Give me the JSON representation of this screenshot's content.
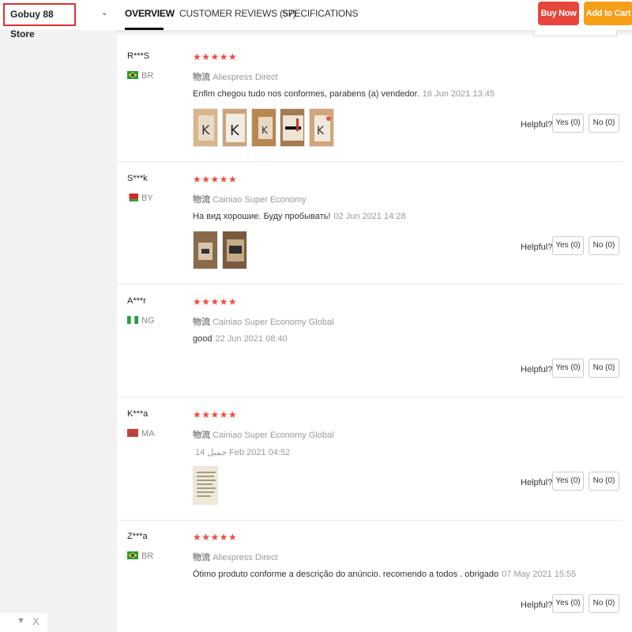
{
  "store": {
    "name": "Gobuy 88 Store",
    "chevron_icon": "chevron-down-icon"
  },
  "tabs": [
    {
      "label": "OVERVIEW",
      "active": true
    },
    {
      "label": "CUSTOMER REVIEWS (57)",
      "active": false
    },
    {
      "label": "SPECIFICATIONS",
      "active": false
    }
  ],
  "actions": {
    "buy_now": "Buy Now",
    "add_to_cart": "Add to Cart"
  },
  "colors": {
    "buy_now": "#e8453c",
    "add_to_cart": "#f59f18",
    "stars": "#f04a3c",
    "store_border": "#e0302e"
  },
  "reviews": [
    {
      "user": "R***S",
      "country": "BR",
      "flag": "brazil",
      "stars": "★★★★★",
      "rating": 5,
      "ship_cn": "物流",
      "shipping": "Aliexpress Direct",
      "text": "Enfim chegou tudo nos conformes, parabens (a) vendedor.",
      "date": "16 Jun 2021 13:45",
      "photos": 5,
      "helpful": "Helpful?",
      "yes": "Yes (0)",
      "no": "No (0)"
    },
    {
      "user": "S***k",
      "country": "BY",
      "flag": "belarus",
      "stars": "★★★★★",
      "rating": 5,
      "ship_cn": "物流",
      "shipping": "Cainiao Super Economy",
      "text": "На вид хорошие. Буду пробывать!",
      "date": "02 Jun 2021 14:28",
      "photos": 2,
      "helpful": "Helpful?",
      "yes": "Yes (0)",
      "no": "No (0)"
    },
    {
      "user": "A***r",
      "country": "NG",
      "flag": "nigeria",
      "stars": "★★★★★",
      "rating": 5,
      "ship_cn": "物流",
      "shipping": "Cainiao Super Economy Global",
      "text": "good",
      "date": "22 Jun 2021 08:40",
      "photos": 0,
      "helpful": "Helpful?",
      "yes": "Yes (0)",
      "no": "No (0)"
    },
    {
      "user": "K***a",
      "country": "MA",
      "flag": "morocco",
      "stars": "★★★★★",
      "rating": 5,
      "ship_cn": "物流",
      "shipping": "Cainiao Super Economy Global",
      "text": "",
      "date": "14 جميل Feb 2021 04:52",
      "photos": 1,
      "helpful": "Helpful?",
      "yes": "Yes (0)",
      "no": "No (0)"
    },
    {
      "user": "Z***a",
      "country": "BR",
      "flag": "brazil",
      "stars": "★★★★★",
      "rating": 5,
      "ship_cn": "物流",
      "shipping": "Aliexpress Direct",
      "text": "Ótimo produto conforme a descrição do anúncio. recomendo a todos . obrigado",
      "date": "07 May 2021 15:55",
      "photos": 0,
      "helpful": "Helpful?",
      "yes": "Yes (0)",
      "no": "No (0)"
    }
  ],
  "bottom_controls": {
    "collapse": "▼",
    "close": "X"
  }
}
